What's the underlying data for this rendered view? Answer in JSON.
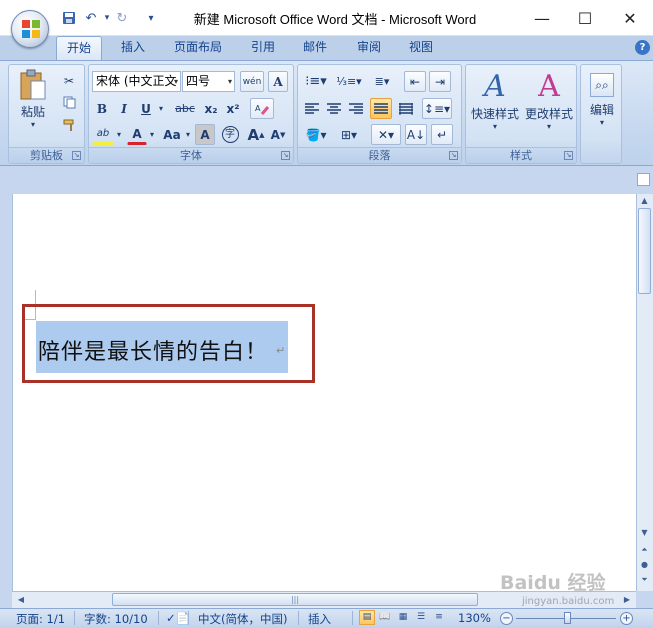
{
  "window": {
    "title": "新建 Microsoft Office Word 文档 - Microsoft Word",
    "minimize": "—",
    "maximize": "☐",
    "close": "✕"
  },
  "qat": {
    "save_icon": "💾",
    "undo_icon": "↶",
    "redo_icon": "↻",
    "customize_icon": "▾"
  },
  "tabs": [
    "开始",
    "插入",
    "页面布局",
    "引用",
    "邮件",
    "审阅",
    "视图"
  ],
  "help": "?",
  "ribbon": {
    "clipboard": {
      "label": "剪贴板",
      "paste": "粘贴"
    },
    "font": {
      "label": "字体",
      "font_name": "宋体 (中文正文",
      "font_size": "四号",
      "phonetic": "wén",
      "bold": "B",
      "italic": "I",
      "underline": "U",
      "strikethrough": "abc",
      "subscript": "x₂",
      "superscript": "x²",
      "highlight": "ab",
      "font_color": "A",
      "change_case": "Aa",
      "char_shading": "A",
      "enclose": "字",
      "grow": "A",
      "shrink": "A"
    },
    "paragraph": {
      "label": "段落"
    },
    "styles": {
      "label": "样式",
      "quick_styles": "快速样式",
      "change_styles": "更改样式"
    },
    "editing": {
      "label": "编辑"
    }
  },
  "document": {
    "text": "陪伴是最长情的告白！",
    "para_mark": "↵"
  },
  "status": {
    "page": "页面: 1/1",
    "words": "字数: 10/10",
    "language": "中文(简体，中国)",
    "mode": "插入",
    "zoom": "130%",
    "zoom_minus": "−",
    "zoom_plus": "+"
  },
  "watermark": {
    "text": "Baidu 经验",
    "sub": "jingyan.baidu.com"
  }
}
